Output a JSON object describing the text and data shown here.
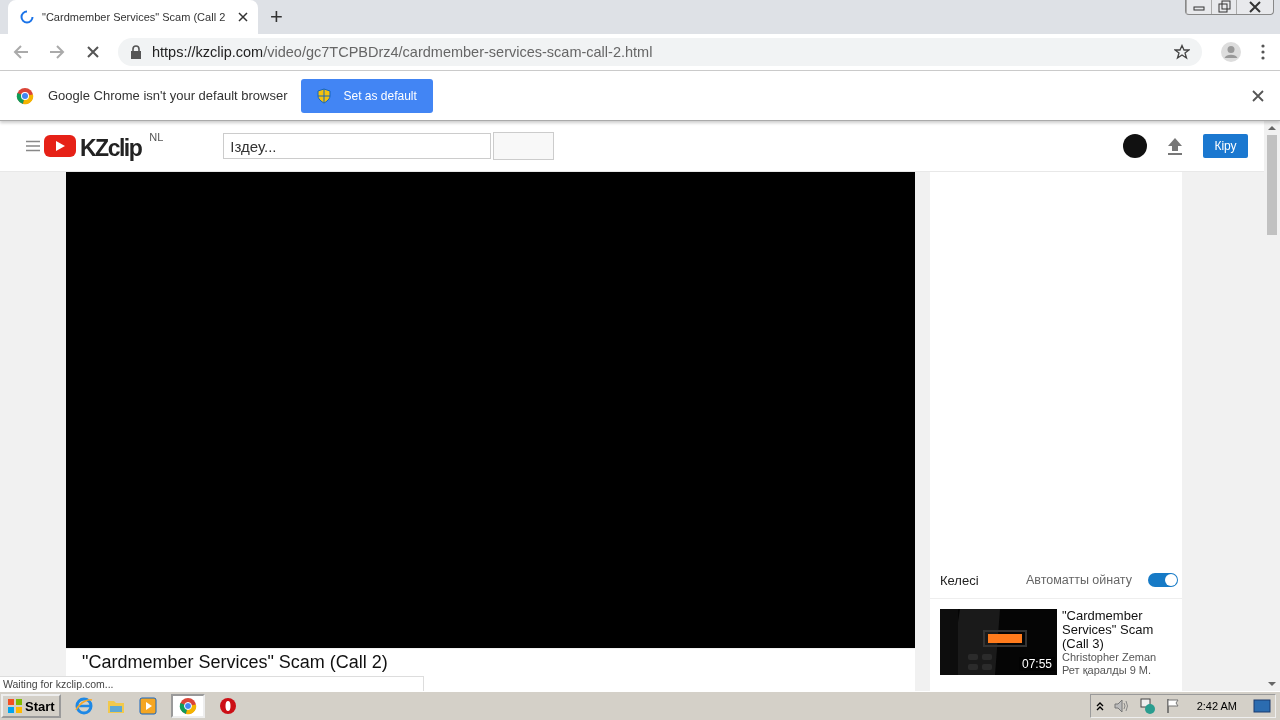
{
  "browser": {
    "tab": {
      "title": "\"Cardmember Services\" Scam (Call 2",
      "loading": true
    },
    "new_tab_label": "+",
    "url": {
      "host": "https://kzclip.com",
      "path": "/video/gc7TCPBDrz4/cardmember-services-scam-call-2.html"
    }
  },
  "infobar": {
    "message": "Google Chrome isn't your default browser",
    "button": "Set as default"
  },
  "site": {
    "logo": "KZclip",
    "region": "NL",
    "search": {
      "placeholder": "Іздеу..."
    },
    "login_button": "Кіру"
  },
  "video": {
    "title": "\"Cardmember Services\" Scam (Call 2)"
  },
  "sidebar": {
    "next_label": "Келесі",
    "autoplay": {
      "label": "Автоматты ойнату",
      "on": true
    },
    "suggestions": [
      {
        "title": "\"Cardmember Services\" Scam (Call 3)",
        "duration": "07:55",
        "channel": "Christopher Zeman",
        "views": "Рет қаралды 9 М."
      }
    ]
  },
  "status_text": "Waiting for kzclip.com...",
  "taskbar": {
    "start": "Start",
    "clock": "2:42 AM"
  }
}
